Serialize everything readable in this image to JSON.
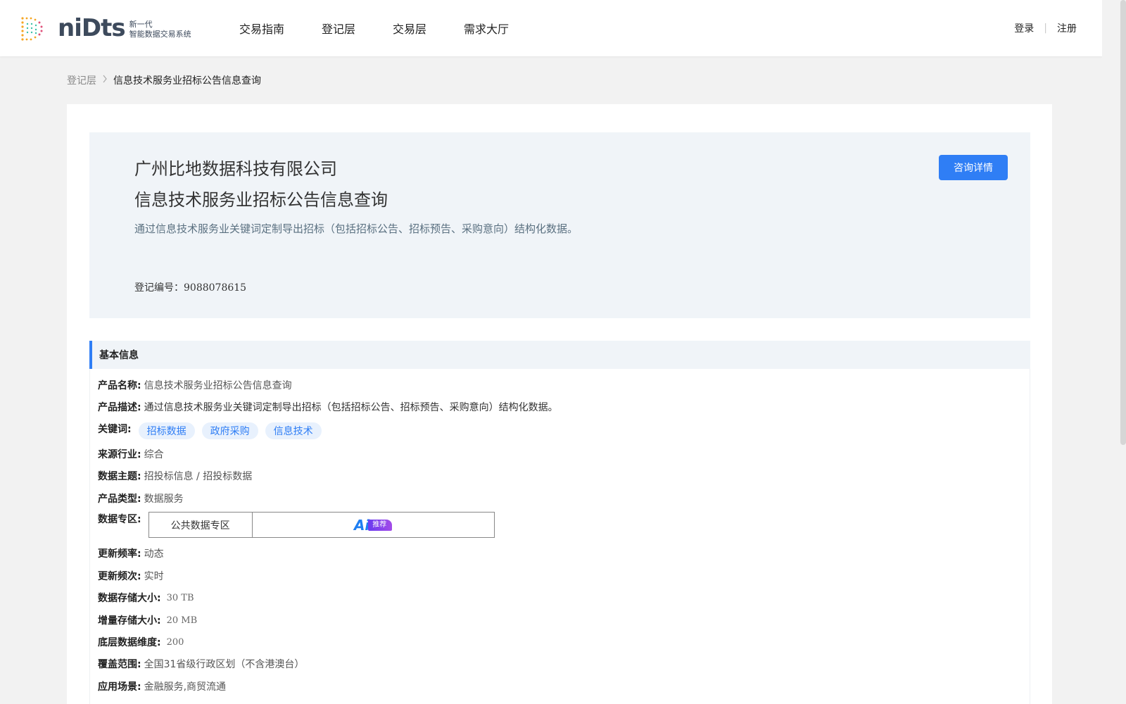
{
  "brand": {
    "name_prefix": "ni",
    "name_suffix": "ts",
    "name_mid": "D",
    "sub_line1": "新一代",
    "sub_line2": "智能数据交易系统"
  },
  "nav": {
    "items": [
      "交易指南",
      "登记层",
      "交易层",
      "需求大厅"
    ]
  },
  "user": {
    "login": "登录",
    "separator": "|",
    "register": "注册"
  },
  "breadcrumb": {
    "parent": "登记层",
    "separator": ">",
    "current": "信息技术服务业招标公告信息查询"
  },
  "hero": {
    "company": "广州比地数据科技有限公司",
    "title": "信息技术服务业招标公告信息查询",
    "description": "通过信息技术服务业关键词定制导出招标（包括招标公告、招标预告、采购意向）结构化数据。",
    "reg_label": "登记编号：",
    "reg_number": "9088078615",
    "consult_button": "咨询详情"
  },
  "section": {
    "title": "基本信息"
  },
  "info": {
    "product_name": {
      "label": "产品名称:",
      "value": "信息技术服务业招标公告信息查询"
    },
    "product_desc": {
      "label": "产品描述:",
      "value": "通过信息技术服务业关键词定制导出招标（包括招标公告、招标预告、采购意向）结构化数据。"
    },
    "keywords": {
      "label": "关键词:",
      "tags": [
        "招标数据",
        "政府采购",
        "信息技术"
      ]
    },
    "industry": {
      "label": "来源行业:",
      "value": "综合"
    },
    "theme": {
      "label": "数据主题:",
      "value": "招投标信息 / 招投标数据"
    },
    "type": {
      "label": "产品类型:",
      "value": "数据服务"
    },
    "zone": {
      "label": "数据专区:",
      "cell": "公共数据专区",
      "badge_mark": "Ai",
      "badge_text": "推荐"
    },
    "freq": {
      "label": "更新频率:",
      "value": "动态"
    },
    "times": {
      "label": "更新频次:",
      "value": "实时"
    },
    "storage": {
      "label": "数据存储大小:",
      "value": "30 TB"
    },
    "increment": {
      "label": "增量存储大小:",
      "value": "20 MB"
    },
    "dimension": {
      "label": "底层数据维度:",
      "value": "200"
    },
    "coverage": {
      "label": "覆盖范围:",
      "value": "全国31省级行政区划（不含港澳台）"
    },
    "scenario": {
      "label": "应用场景:",
      "value": "金融服务,商贸流通"
    }
  },
  "colors": {
    "accent": "#2f7ef5",
    "hero_bg": "#f0f4f8",
    "page_bg": "#f2f2f2"
  }
}
